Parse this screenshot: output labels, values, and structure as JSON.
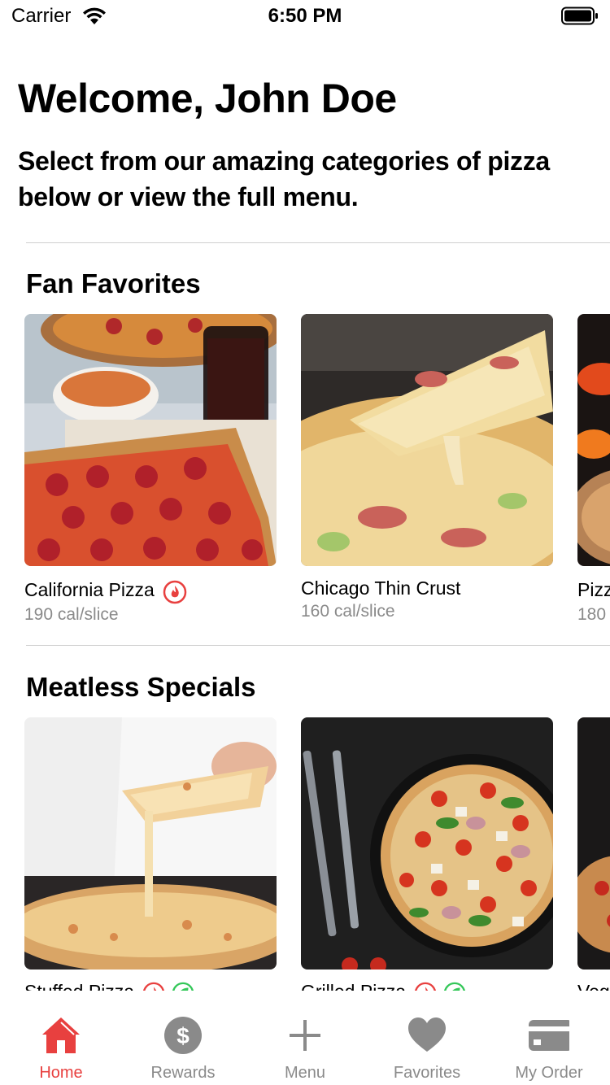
{
  "status_bar": {
    "carrier": "Carrier",
    "time": "6:50 PM"
  },
  "header": {
    "title": "Welcome, John Doe",
    "subtitle": "Select from our amazing categories of pizza below or view the full menu."
  },
  "sections": [
    {
      "title": "Fan Favorites",
      "cards": [
        {
          "name": "California Pizza",
          "calories": "190 cal/slice",
          "badges": [
            "spicy"
          ]
        },
        {
          "name": "Chicago Thin Crust",
          "calories": "160 cal/slice",
          "badges": []
        },
        {
          "name": "Pizz",
          "calories": "180",
          "badges": []
        }
      ]
    },
    {
      "title": "Meatless Specials",
      "cards": [
        {
          "name": "Stuffed Pizza",
          "calories": "",
          "badges": [
            "spicy",
            "vegetarian"
          ]
        },
        {
          "name": "Grilled Pizza",
          "calories": "",
          "badges": [
            "spicy",
            "vegetarian"
          ]
        },
        {
          "name": "Veg",
          "calories": "",
          "badges": []
        }
      ]
    }
  ],
  "tabs": [
    {
      "label": "Home",
      "icon": "house-icon",
      "active": true
    },
    {
      "label": "Rewards",
      "icon": "dollar-circle-icon",
      "active": false
    },
    {
      "label": "Menu",
      "icon": "plus-icon",
      "active": false
    },
    {
      "label": "Favorites",
      "icon": "heart-icon",
      "active": false
    },
    {
      "label": "My Order",
      "icon": "credit-card-icon",
      "active": false
    }
  ],
  "colors": {
    "accent": "#e8403f",
    "spicy": "#e8403f",
    "vegetarian": "#34c759",
    "inactive": "#8a8a8a"
  }
}
